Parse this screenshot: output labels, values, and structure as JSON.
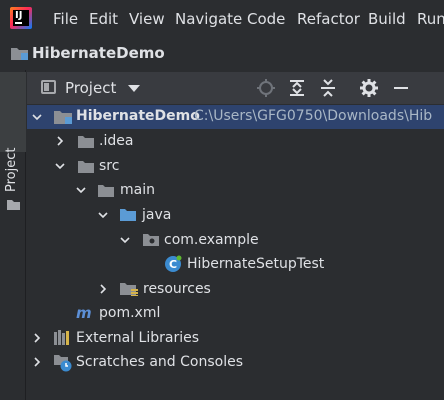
{
  "menu": {
    "items": [
      "File",
      "Edit",
      "View",
      "Navigate",
      "Code",
      "Refactor",
      "Build",
      "Run"
    ]
  },
  "breadcrumb": {
    "project": "HibernateDemo"
  },
  "toolwindow": {
    "side_tab": "Project"
  },
  "panel": {
    "title": "Project"
  },
  "tree": {
    "root": {
      "name": "HibernateDemo",
      "path": "C:\\Users\\GFG0750\\Downloads\\Hib"
    },
    "idea": ".idea",
    "src": "src",
    "main": "main",
    "java": "java",
    "package": "com.example",
    "class": "HibernateSetupTest",
    "resources": "resources",
    "pom": "pom.xml",
    "external": "External Libraries",
    "scratches": "Scratches and Consoles"
  },
  "colors": {
    "background": "#2b2d30",
    "selection": "#2e436e",
    "folder_blue": "#5b9bd5",
    "folder_gray": "#8c8f94",
    "maven_blue": "#5c8fd6",
    "class_blue": "#3b8bd0"
  },
  "icons": {
    "logo": "intellij-logo-icon",
    "panel": "project-view-icon",
    "header_actions": [
      "locate-icon",
      "expand-all-icon",
      "collapse-all-icon",
      "gear-icon",
      "minimize-icon"
    ]
  }
}
